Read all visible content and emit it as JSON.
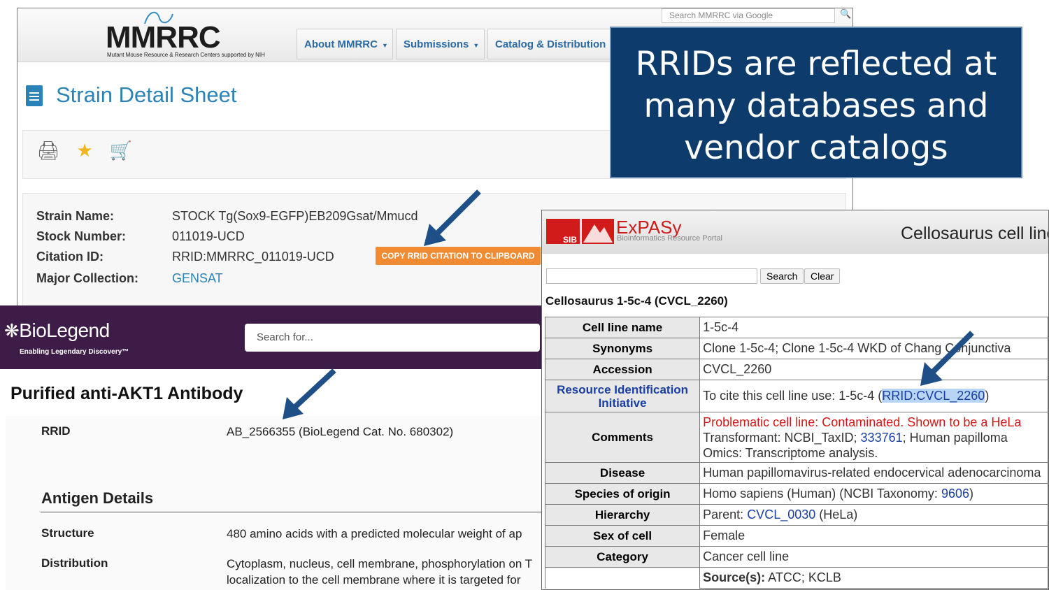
{
  "callout": {
    "text": "RRIDs are reflected at many databases and vendor catalogs"
  },
  "mmrrc": {
    "logo": "MMRRC",
    "logo_sub": "Mutant Mouse Resource & Research Centers supported by NIH",
    "nav": [
      "About MMRRC",
      "Submissions",
      "Catalog & Distribution"
    ],
    "search_placeholder": "Search MMRRC via Google",
    "page_title": "Strain Detail Sheet",
    "details": [
      {
        "label": "Strain Name:",
        "value": "STOCK Tg(Sox9-EGFP)EB209Gsat/Mmucd"
      },
      {
        "label": "Stock Number:",
        "value": "011019-UCD"
      },
      {
        "label": "Citation ID:",
        "value": "RRID:MMRRC_011019-UCD"
      },
      {
        "label": "Major Collection:",
        "value": "GENSAT"
      }
    ],
    "copy_button": "COPY RRID CITATION TO CLIPBOARD",
    "link_color": "#2a82b6",
    "button_color": "#f08a33"
  },
  "biolegend": {
    "brand": "BioLegend",
    "tagline": "Enabling Legendary Discovery™",
    "search_placeholder": "Search for...",
    "product_title": "Purified anti-AKT1 Antibody",
    "rrid_label": "RRID",
    "rrid_value": "AB_2566355 (BioLegend Cat. No. 680302)",
    "antigen_title": "Antigen Details",
    "structure_label": "Structure",
    "structure_value": "480 amino acids with a predicted molecular weight of ap",
    "distribution_label": "Distribution",
    "distribution_line1": "Cytoplasm, nucleus, cell membrane, phosphorylation on T",
    "distribution_line2": "localization to the cell membrane where it is targeted for",
    "header_color": "#3d1d48"
  },
  "cellosaurus": {
    "sib": "SIB",
    "expasy": "ExPASy",
    "portal": "Bioinformatics Resource Portal",
    "title": "Cellosaurus cell line",
    "search_button": "Search",
    "clear_button": "Clear",
    "entry_title": "Cellosaurus 1-5c-4 (CVCL_2260)",
    "rows": {
      "cell_line_name": {
        "k": "Cell line name",
        "v": "1-5c-4"
      },
      "synonyms": {
        "k": "Synonyms",
        "v": "Clone 1-5c-4; Clone 1-5c-4 WKD of Chang Conjunctiva"
      },
      "accession": {
        "k": "Accession",
        "v": "CVCL_2260"
      },
      "rii": {
        "k": "Resource Identification Initiative",
        "v_prefix": "To cite this cell line use: 1-5c-4 (",
        "v_rrid": "RRID:CVCL_2260",
        "v_suffix": ")"
      },
      "comments": {
        "k": "Comments",
        "line1": "Problematic cell line: Contaminated. Shown to be a HeLa",
        "line2_prefix": "Transformant: NCBI_TaxID; ",
        "line2_link": "333761",
        "line2_suffix": "; Human papilloma",
        "line3": "Omics: Transcriptome analysis."
      },
      "disease": {
        "k": "Disease",
        "v": "Human papillomavirus-related endocervical adenocarcinoma"
      },
      "species": {
        "k": "Species of origin",
        "v_prefix": "Homo sapiens (Human) (NCBI Taxonomy: ",
        "v_link": "9606",
        "v_suffix": ")"
      },
      "hierarchy": {
        "k": "Hierarchy",
        "v_prefix": "Parent: ",
        "v_link": "CVCL_0030",
        "v_suffix": " (HeLa)"
      },
      "sex": {
        "k": "Sex of cell",
        "v": "Female"
      },
      "category": {
        "k": "Category",
        "v": "Cancer cell line"
      },
      "source": {
        "label": "Source(s):",
        "v": " ATCC; KCLB"
      }
    },
    "link_color": "#1a3fa3",
    "alert_color": "#d51616"
  }
}
